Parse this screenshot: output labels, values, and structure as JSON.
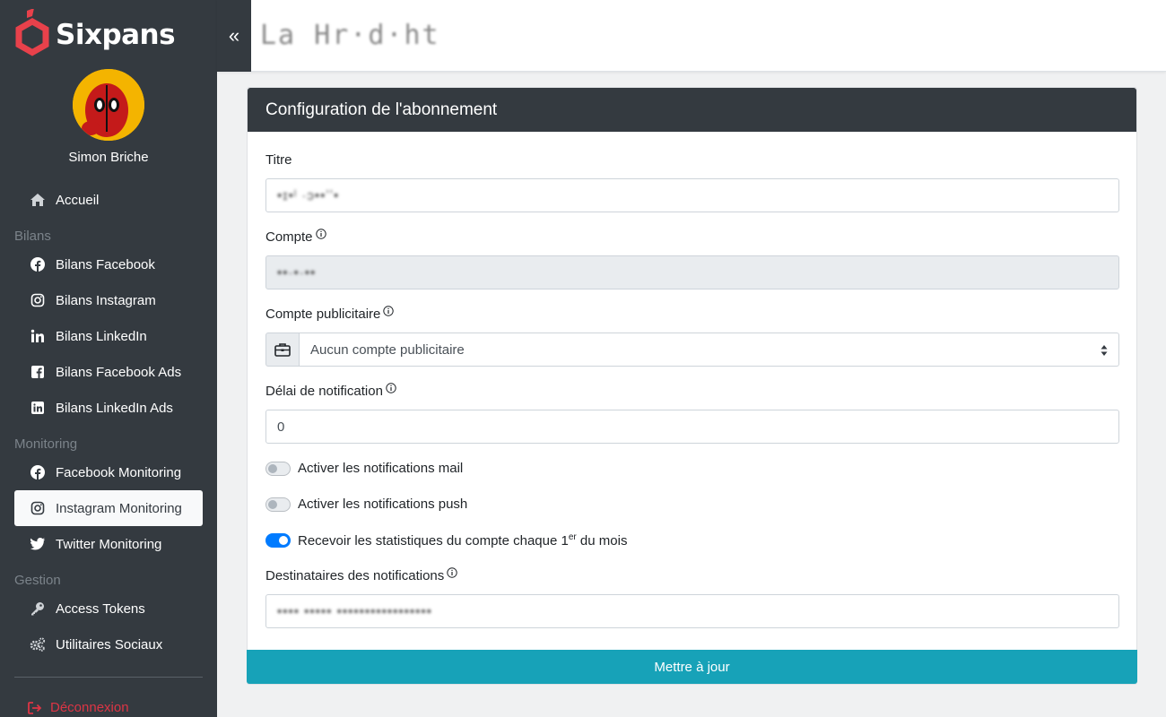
{
  "brand": {
    "name": "Sixpans",
    "accent": "#e8414b"
  },
  "user": {
    "name": "Simon Briche"
  },
  "sidebar": {
    "items": [
      {
        "label": "Accueil",
        "icon": "home-icon"
      },
      {
        "label": "Bilans Facebook",
        "icon": "facebook-icon"
      },
      {
        "label": "Bilans Instagram",
        "icon": "instagram-icon"
      },
      {
        "label": "Bilans LinkedIn",
        "icon": "linkedin-icon"
      },
      {
        "label": "Bilans Facebook Ads",
        "icon": "facebook-square-icon"
      },
      {
        "label": "Bilans LinkedIn Ads",
        "icon": "linkedin-square-icon"
      },
      {
        "label": "Facebook Monitoring",
        "icon": "facebook-icon"
      },
      {
        "label": "Instagram Monitoring",
        "icon": "instagram-icon",
        "active": true
      },
      {
        "label": "Twitter Monitoring",
        "icon": "twitter-icon"
      },
      {
        "label": "Access Tokens",
        "icon": "key-icon"
      },
      {
        "label": "Utilitaires Sociaux",
        "icon": "cogs-icon"
      }
    ],
    "sections": [
      "Bilans",
      "Monitoring",
      "Gestion"
    ],
    "logout": "Déconnexion"
  },
  "topbar": {
    "collapse_icon": "double-chevron-left-icon",
    "title": "La Hr·d·ht"
  },
  "form": {
    "header": "Configuration de l'abonnement",
    "titre_label": "Titre",
    "titre_value": "•ɪ•ˡ ·ɔ••ʼʼ•",
    "compte_label": "Compte",
    "compte_value": "••·•·••",
    "compte_pub_label": "Compte publicitaire",
    "compte_pub_value": "Aucun compte publicitaire",
    "delai_label": "Délai de notification",
    "delai_value": "0",
    "switch_mail": "Activer les notifications mail",
    "switch_push": "Activer les notifications push",
    "switch_stats_prefix": "Recevoir les statistiques du compte chaque 1",
    "switch_stats_sup": "er",
    "switch_stats_suffix": " du mois",
    "dest_label": "Destinataires des notifications",
    "dest_value": "•••• ••••• •••••••••••••••••",
    "submit": "Mettre à jour"
  },
  "states": {
    "mail_enabled": false,
    "push_enabled": false,
    "stats_enabled": true
  },
  "colors": {
    "sidebar_bg": "#343a40",
    "primary": "#007bff",
    "submit_bg": "#17a2b8",
    "danger": "#dc3545"
  }
}
